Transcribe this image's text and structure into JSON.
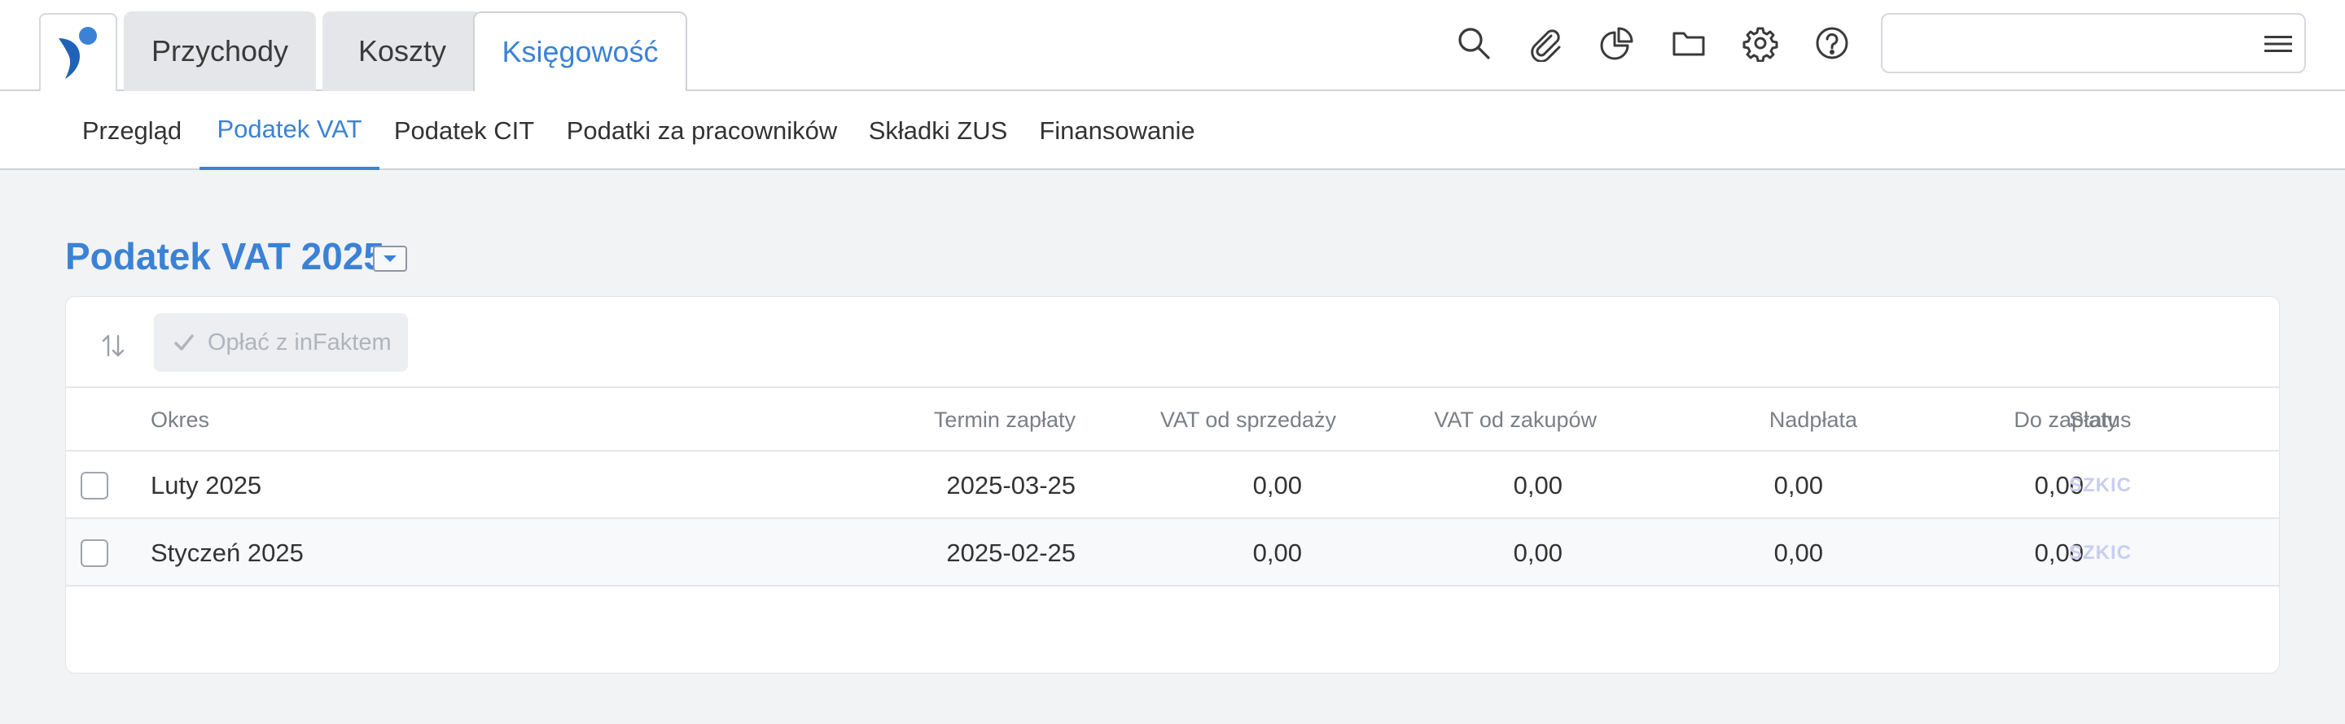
{
  "top_tabs": [
    {
      "label": "Przychody"
    },
    {
      "label": "Koszty"
    },
    {
      "label": "Księgowość"
    }
  ],
  "top_icons": [
    "search-icon",
    "paperclip-icon",
    "pie-chart-icon",
    "folder-icon",
    "gear-icon",
    "help-icon"
  ],
  "search": {
    "value": ""
  },
  "subnav": [
    {
      "label": "Przegląd"
    },
    {
      "label": "Podatek VAT"
    },
    {
      "label": "Podatek CIT"
    },
    {
      "label": "Podatki za pracowników"
    },
    {
      "label": "Składki ZUS"
    },
    {
      "label": "Finansowanie"
    }
  ],
  "page": {
    "title": "Podatek VAT 2025"
  },
  "toolbar": {
    "pay_label": "Opłać z inFaktem"
  },
  "table": {
    "headers": {
      "period": "Okres",
      "due_date": "Termin zapłaty",
      "vat_sales": "VAT od sprzedaży",
      "vat_purchases": "VAT od zakupów",
      "overpayment": "Nadpłata",
      "to_pay": "Do zapłaty",
      "status": "Status"
    },
    "rows": [
      {
        "period": "Luty 2025",
        "due_date": "2025-03-25",
        "vat_sales": "0,00",
        "vat_purchases": "0,00",
        "overpayment": "0,00",
        "to_pay": "0,00",
        "status": "SZKIC"
      },
      {
        "period": "Styczeń 2025",
        "due_date": "2025-02-25",
        "vat_sales": "0,00",
        "vat_purchases": "0,00",
        "overpayment": "0,00",
        "to_pay": "0,00",
        "status": "SZKIC"
      }
    ]
  },
  "colors": {
    "accent": "#3b82d6",
    "status_draft": "#c9cdf0"
  }
}
